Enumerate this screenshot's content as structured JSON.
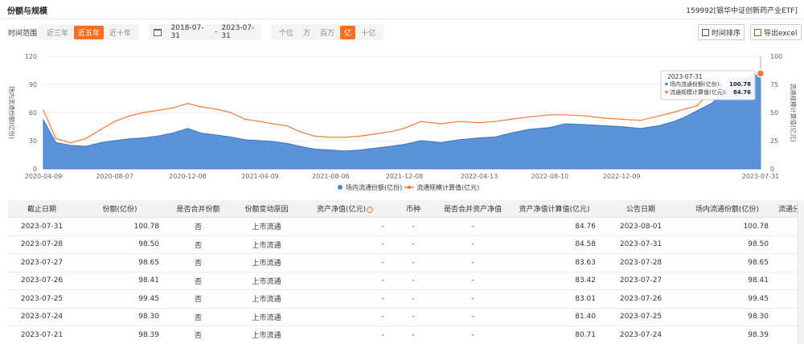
{
  "header": {
    "title": "份额与规模",
    "fund": "159992[银华中证创新药产业ETF]"
  },
  "toolbar": {
    "range_label": "时间范围",
    "ranges": [
      "近三年",
      "近五年",
      "近十年"
    ],
    "date_start": "2018-07-31",
    "date_sep": "-",
    "date_end": "2023-07-31",
    "units": [
      "个位",
      "万",
      "百万",
      "亿",
      "十亿"
    ],
    "sort_label": "时间排序",
    "export_label": "导出excel"
  },
  "colors": {
    "accent": "#f86f1f",
    "area": "#4a86d4",
    "line": "#f4793b"
  },
  "chart_data": {
    "type": "area",
    "x": [
      "2020-04-09",
      "2020-04-30",
      "2020-05-25",
      "2020-06-20",
      "2020-07-15",
      "2020-08-07",
      "2020-09-01",
      "2020-09-25",
      "2020-10-20",
      "2020-11-12",
      "2020-12-08",
      "2020-12-31",
      "2021-01-25",
      "2021-02-18",
      "2021-03-15",
      "2021-04-09",
      "2021-05-01",
      "2021-05-25",
      "2021-06-15",
      "2021-07-10",
      "2021-08-06",
      "2021-08-30",
      "2021-09-24",
      "2021-10-20",
      "2021-11-15",
      "2021-12-08",
      "2022-01-05",
      "2022-02-08",
      "2022-03-10",
      "2022-04-13",
      "2022-05-10",
      "2022-06-05",
      "2022-07-05",
      "2022-08-10",
      "2022-09-05",
      "2022-10-10",
      "2022-11-10",
      "2022-12-09",
      "2023-01-10",
      "2023-02-10",
      "2023-03-05",
      "2023-03-25",
      "2023-04-15",
      "2023-05-10",
      "2023-06-05",
      "2023-06-30",
      "2023-07-31"
    ],
    "series": [
      {
        "name": "场内流通份额(亿份)",
        "axis": "left",
        "values": [
          52,
          28,
          25,
          24,
          28,
          30,
          32,
          33,
          35,
          38,
          43,
          38,
          36,
          34,
          31,
          30,
          29,
          27,
          24,
          21,
          20,
          19,
          20,
          22,
          24,
          26,
          30,
          28,
          31,
          33,
          34,
          38,
          42,
          44,
          48,
          47,
          46,
          45,
          43,
          46,
          50,
          55,
          62,
          70,
          85,
          95,
          100.78
        ]
      },
      {
        "name": "流通规模计算值(亿元)",
        "axis": "right",
        "values": [
          52,
          27,
          23,
          27,
          35,
          42,
          47,
          50,
          52,
          54,
          58,
          55,
          53,
          50,
          44,
          42,
          40,
          38,
          33,
          29,
          28,
          28,
          29,
          31,
          33,
          36,
          42,
          40,
          42,
          41,
          42,
          44,
          46,
          48,
          48,
          47,
          45,
          44,
          43,
          47,
          50,
          53,
          56,
          70,
          76,
          80,
          84.76
        ]
      }
    ],
    "xticks": [
      "2020-04-09",
      "2020-08-07",
      "2020-12-08",
      "2021-04-09",
      "2021-08-06",
      "2021-12-08",
      "2022-04-13",
      "2022-08-10",
      "2022-12-09",
      "2023-07-31"
    ],
    "ylim_left": [
      0,
      120
    ],
    "yticks_left": [
      "0",
      "30",
      "60",
      "90",
      "120"
    ],
    "ylim_right": [
      0,
      100
    ],
    "yticks_right": [
      "0",
      "25",
      "50",
      "75",
      "100"
    ],
    "ylabel_left": "场内流通份额(亿份)",
    "ylabel_right": "流通规模计算值(亿元)",
    "legend_placement": "bottom",
    "tooltip": {
      "date": "2023-07-31",
      "items": [
        {
          "label": "场内流通份额(亿份):",
          "value": "100.78"
        },
        {
          "label": "流通规模计算值(亿元):",
          "value": "84.76"
        }
      ]
    }
  },
  "table": {
    "columns": [
      "截止日期",
      "份额(亿份)",
      "是否合并份额",
      "份额变动原因",
      "资产净值(亿元)",
      "币种",
      "是否合并资产净值",
      "资产净值计算值(亿元)",
      "公告日期",
      "场内流通份额(亿份)",
      "流通分"
    ],
    "rows": [
      [
        "2023-07-31",
        "100.78",
        "否",
        "上市流通",
        "-",
        "-",
        "-",
        "84.76",
        "2023-08-01",
        "100.78",
        ""
      ],
      [
        "2023-07-28",
        "98.50",
        "否",
        "上市流通",
        "-",
        "-",
        "-",
        "84.58",
        "2023-07-31",
        "98.50",
        ""
      ],
      [
        "2023-07-27",
        "98.65",
        "否",
        "上市流通",
        "-",
        "-",
        "-",
        "83.63",
        "2023-07-28",
        "98.65",
        ""
      ],
      [
        "2023-07-26",
        "98.41",
        "否",
        "上市流通",
        "-",
        "-",
        "-",
        "83.42",
        "2023-07-27",
        "98.41",
        ""
      ],
      [
        "2023-07-25",
        "99.45",
        "否",
        "上市流通",
        "-",
        "-",
        "-",
        "83.01",
        "2023-07-26",
        "99.45",
        ""
      ],
      [
        "2023-07-24",
        "98.30",
        "否",
        "上市流通",
        "-",
        "-",
        "-",
        "81.40",
        "2023-07-25",
        "98.30",
        ""
      ],
      [
        "2023-07-21",
        "98.39",
        "否",
        "上市流通",
        "-",
        "-",
        "-",
        "80.71",
        "2023-07-24",
        "98.39",
        ""
      ]
    ]
  }
}
